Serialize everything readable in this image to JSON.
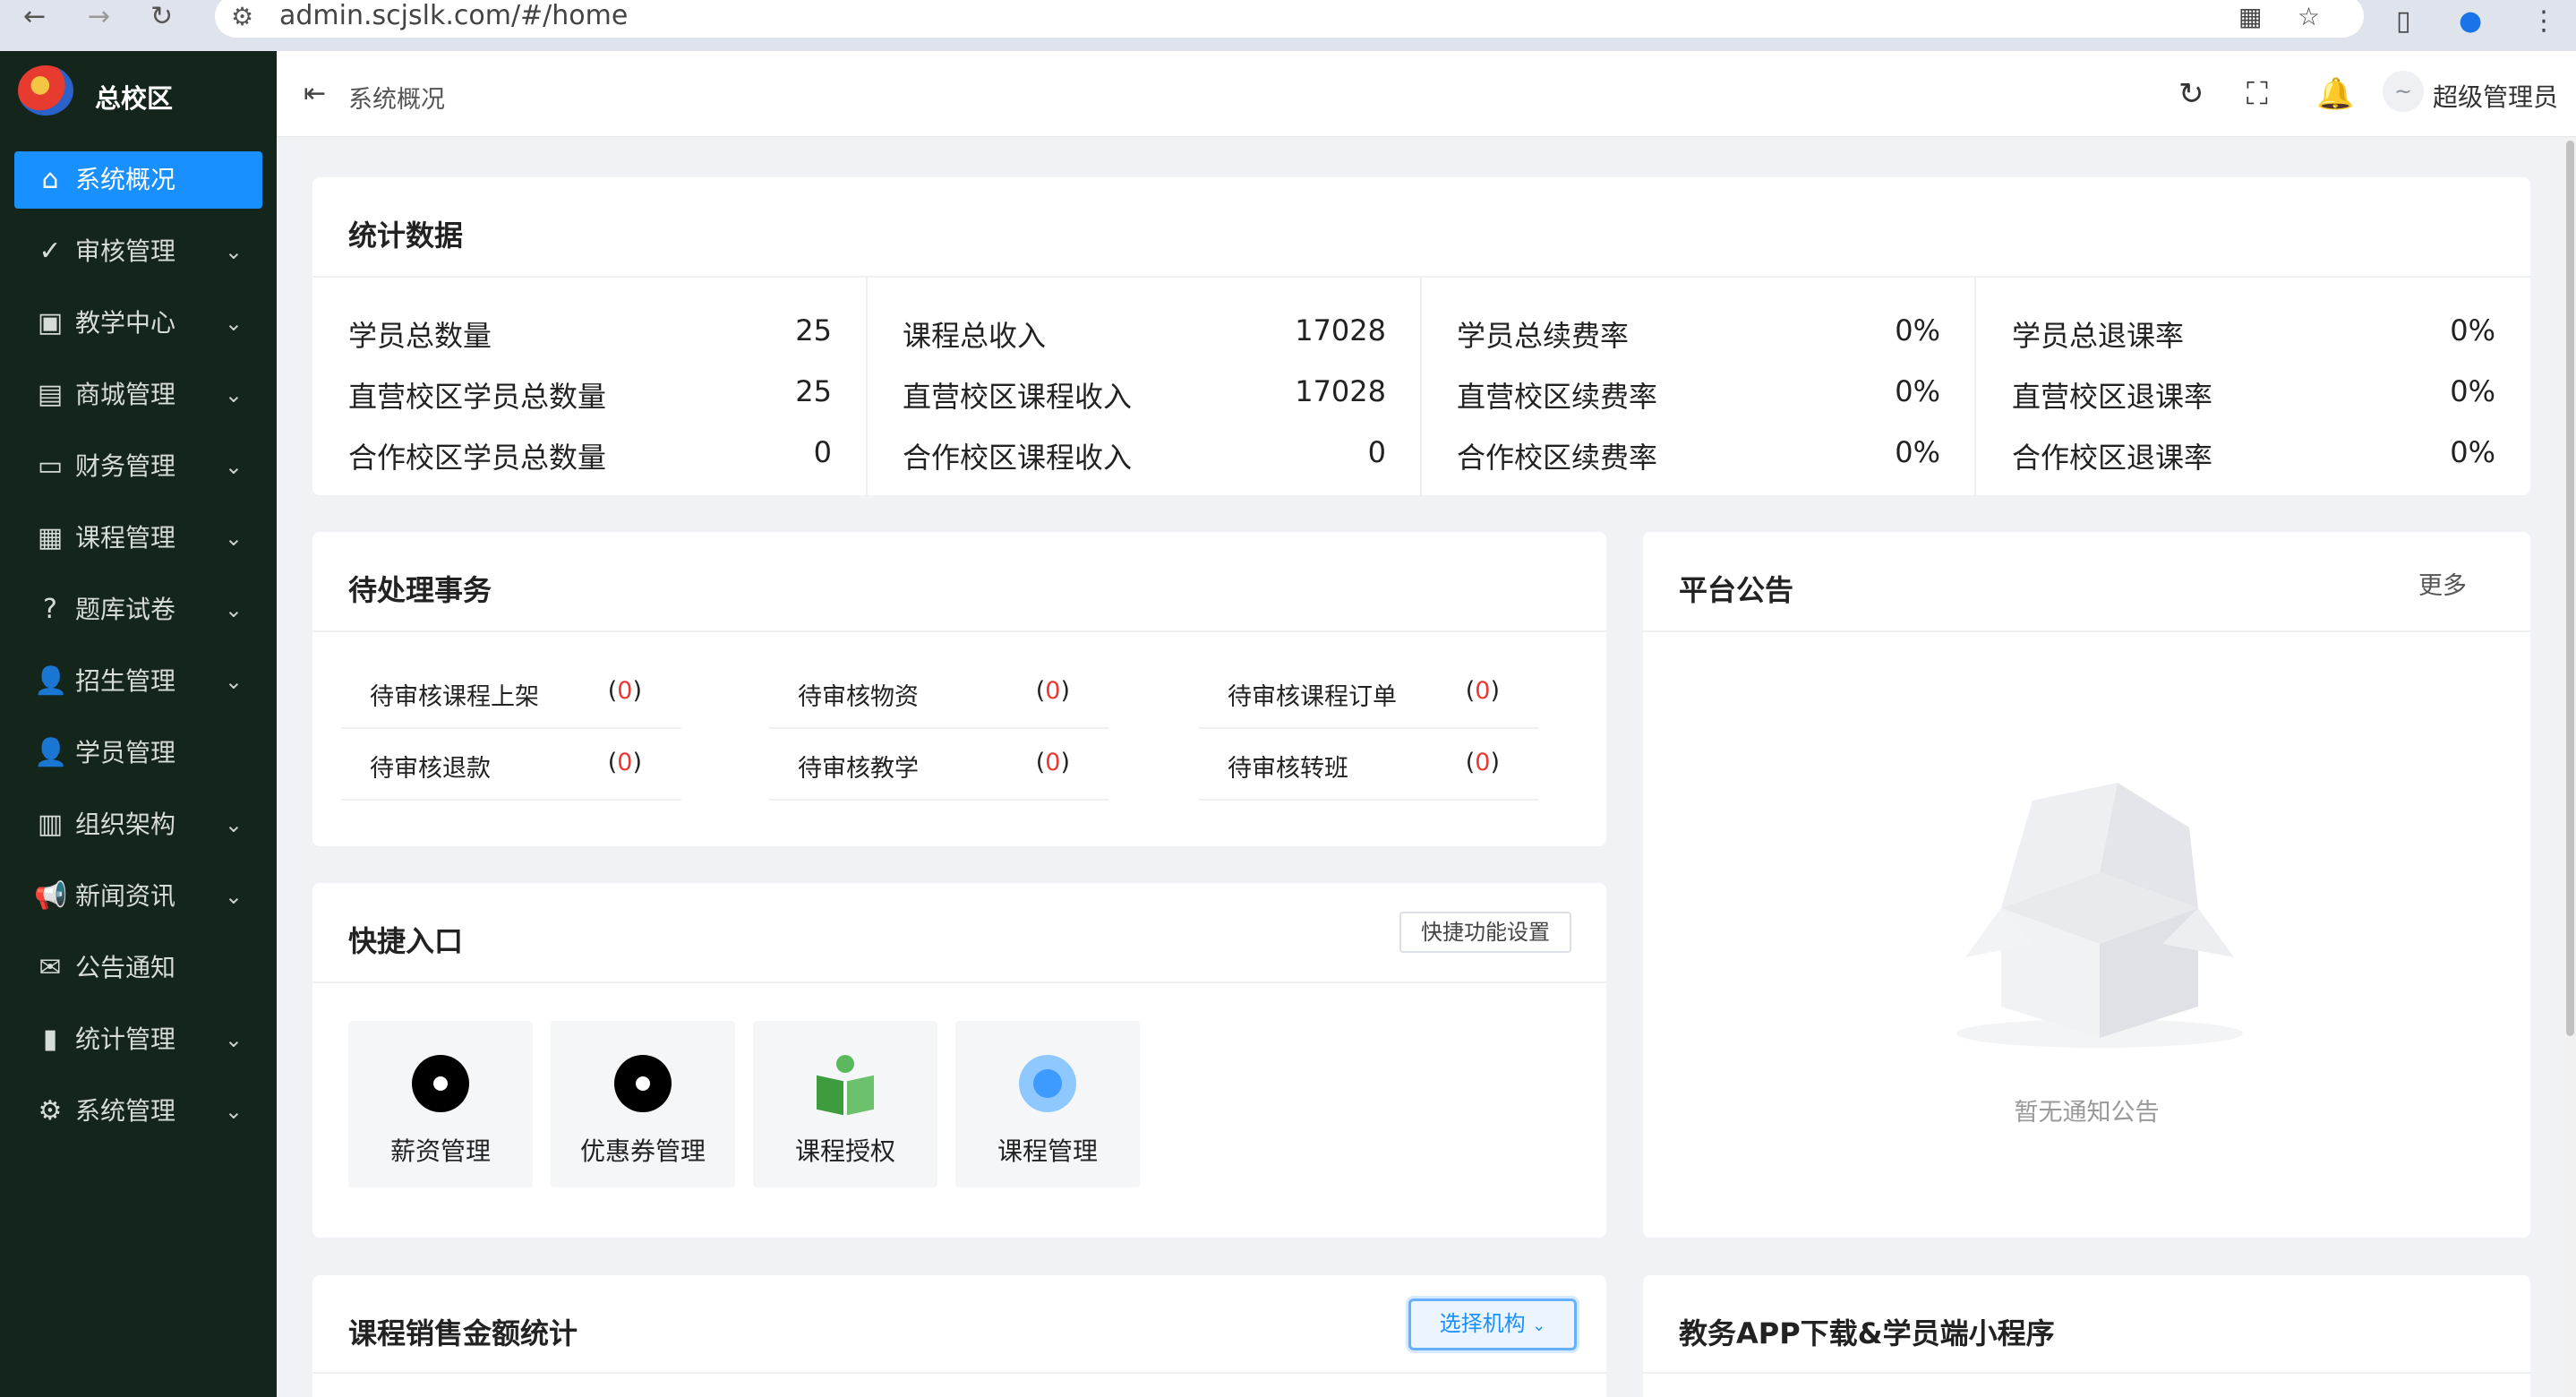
{
  "browser": {
    "url": "admin.scjslk.com/#/home"
  },
  "sidebar": {
    "brand": "总校区",
    "items": [
      {
        "label": "系统概况",
        "icon": "home-icon",
        "glyph": "⌂",
        "active": true,
        "arrow": false
      },
      {
        "label": "审核管理",
        "icon": "check-circle-icon",
        "glyph": "✓",
        "arrow": true
      },
      {
        "label": "教学中心",
        "icon": "teaching-icon",
        "glyph": "▣",
        "arrow": true
      },
      {
        "label": "商城管理",
        "icon": "gift-icon",
        "glyph": "▤",
        "arrow": true
      },
      {
        "label": "财务管理",
        "icon": "money-icon",
        "glyph": "▭",
        "arrow": true
      },
      {
        "label": "课程管理",
        "icon": "course-icon",
        "glyph": "▦",
        "arrow": true
      },
      {
        "label": "题库试卷",
        "icon": "question-icon",
        "glyph": "?",
        "arrow": true
      },
      {
        "label": "招生管理",
        "icon": "user-icon",
        "glyph": "👤",
        "arrow": true
      },
      {
        "label": "学员管理",
        "icon": "student-icon",
        "glyph": "👤",
        "arrow": false
      },
      {
        "label": "组织架构",
        "icon": "org-icon",
        "glyph": "▥",
        "arrow": true
      },
      {
        "label": "新闻资讯",
        "icon": "megaphone-icon",
        "glyph": "📢",
        "arrow": true
      },
      {
        "label": "公告通知",
        "icon": "mail-icon",
        "glyph": "✉",
        "arrow": false
      },
      {
        "label": "统计管理",
        "icon": "bar-chart-icon",
        "glyph": "▮",
        "arrow": true
      },
      {
        "label": "系统管理",
        "icon": "gear-icon",
        "glyph": "⚙",
        "arrow": true
      }
    ]
  },
  "header": {
    "breadcrumb": "系统概况",
    "user": "超级管理员"
  },
  "stats": {
    "title": "统计数据",
    "columns": [
      [
        {
          "label": "学员总数量",
          "value": "25"
        },
        {
          "label": "直营校区学员总数量",
          "value": "25"
        },
        {
          "label": "合作校区学员总数量",
          "value": "0"
        }
      ],
      [
        {
          "label": "课程总收入",
          "value": "17028"
        },
        {
          "label": "直营校区课程收入",
          "value": "17028"
        },
        {
          "label": "合作校区课程收入",
          "value": "0"
        }
      ],
      [
        {
          "label": "学员总续费率",
          "value": "0%"
        },
        {
          "label": "直营校区续费率",
          "value": "0%"
        },
        {
          "label": "合作校区续费率",
          "value": "0%"
        }
      ],
      [
        {
          "label": "学员总退课率",
          "value": "0%"
        },
        {
          "label": "直营校区退课率",
          "value": "0%"
        },
        {
          "label": "合作校区退课率",
          "value": "0%"
        }
      ]
    ]
  },
  "pending": {
    "title": "待处理事务",
    "items": [
      {
        "label": "待审核课程上架",
        "count": "0"
      },
      {
        "label": "待审核物资",
        "count": "0"
      },
      {
        "label": "待审核课程订单",
        "count": "0"
      },
      {
        "label": "待审核退款",
        "count": "0"
      },
      {
        "label": "待审核教学",
        "count": "0"
      },
      {
        "label": "待审核转班",
        "count": "0"
      }
    ]
  },
  "announcements": {
    "title": "平台公告",
    "more": "更多",
    "empty": "暂无通知公告"
  },
  "quick": {
    "title": "快捷入口",
    "settings": "快捷功能设置",
    "tiles": [
      {
        "label": "薪资管理",
        "icon": "salary-icon"
      },
      {
        "label": "优惠券管理",
        "icon": "coupon-icon"
      },
      {
        "label": "课程授权",
        "icon": "course-auth-icon"
      },
      {
        "label": "课程管理",
        "icon": "course-manage-icon"
      }
    ]
  },
  "sales": {
    "title": "课程销售金额统计",
    "select": "选择机构"
  },
  "download": {
    "title": "教务APP下载&学员端小程序"
  },
  "colors": {
    "sidebar_bg": "#14251c",
    "accent": "#1890ff",
    "danger": "#e53935"
  }
}
